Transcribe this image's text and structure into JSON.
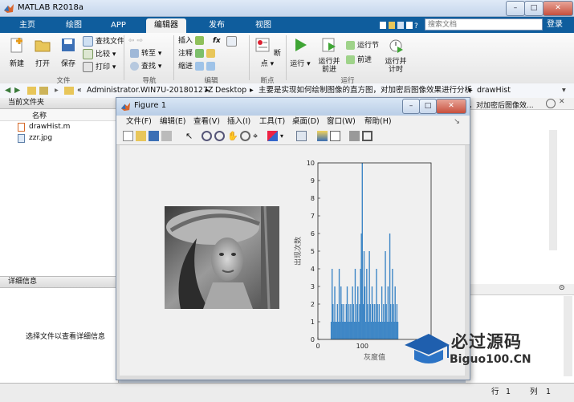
{
  "window": {
    "title": "MATLAB R2018a"
  },
  "window_controls": {
    "minimize": "–",
    "maximize": "□",
    "close": "✕"
  },
  "tabs": [
    "主页",
    "绘图",
    "APP",
    "编辑器",
    "发布",
    "视图"
  ],
  "search": {
    "placeholder": "搜索文档"
  },
  "login": "登录",
  "ribbon": {
    "file": {
      "new": "新建",
      "open": "打开",
      "save": "保存",
      "find_files": "查找文件",
      "compare": "比较",
      "print": "打印",
      "group": "文件"
    },
    "nav": {
      "goto": "转至",
      "find": "查找",
      "group": "导航"
    },
    "edit": {
      "insert": "插入",
      "fx": "fx",
      "comment": "注释",
      "indent": "缩进",
      "group": "编辑"
    },
    "breakpoints": {
      "label": "断点",
      "group": "断点"
    },
    "run": {
      "run": "运行",
      "run_advance": "运行并前进",
      "run_section": "运行节",
      "advance": "前进",
      "run_time": "运行并计时",
      "group": "运行"
    }
  },
  "path": {
    "prefix": "«",
    "segments": [
      "Administrator.WIN7U-20180127Z",
      "Desktop",
      "主要是实现如何绘制图像的直方图，对加密后图像效果进行分析",
      "drawHist"
    ]
  },
  "current_folder": {
    "header": "当前文件夹",
    "column": "名称",
    "files": [
      {
        "name": "drawHist.m",
        "icon": "m-file-icon"
      },
      {
        "name": "zzr.jpg",
        "icon": "image-file-icon"
      }
    ]
  },
  "details": {
    "header": "详细信息",
    "empty_text": "选择文件以查看详细信息"
  },
  "right_panel": {
    "header_text": "，对加密后图像效..."
  },
  "figure": {
    "title": "Figure 1",
    "menu": [
      "文件(F)",
      "编辑(E)",
      "查看(V)",
      "插入(I)",
      "工具(T)",
      "桌面(D)",
      "窗口(W)",
      "帮助(H)"
    ]
  },
  "status": {
    "row_label": "行",
    "row": "1",
    "col_label": "列",
    "col": "1"
  },
  "watermark": {
    "text": "必过源码",
    "url": "Biguo100.CN"
  },
  "colors": {
    "accent": "#0f5d9d",
    "bar": "#3f87c6"
  },
  "chart_data": {
    "type": "bar",
    "xlabel": "灰度值",
    "ylabel": "出现次数",
    "xlim": [
      0,
      255
    ],
    "ylim": [
      0,
      10
    ],
    "yticks": [
      0,
      1,
      2,
      3,
      4,
      5,
      6,
      7,
      8,
      9,
      10
    ],
    "xticks": [
      0,
      100
    ],
    "series": [
      {
        "x": [
          30,
          32,
          34,
          36,
          38,
          40,
          42,
          44,
          46,
          48,
          50,
          52,
          54,
          56,
          58,
          60,
          62,
          64,
          66,
          68,
          70,
          72,
          74,
          76,
          78,
          80,
          82,
          84,
          86,
          88,
          90,
          92,
          94,
          96,
          98,
          100,
          102,
          104,
          106,
          108,
          110,
          112,
          114,
          116,
          118,
          120,
          122,
          124,
          126,
          128,
          130,
          132,
          134,
          136,
          138,
          140,
          142,
          144,
          146,
          148,
          150,
          152,
          154,
          156,
          158,
          160,
          162,
          164,
          166,
          168,
          170,
          172,
          174,
          176,
          178,
          180
        ],
        "y": [
          1,
          4,
          2,
          1,
          3,
          1,
          1,
          2,
          1,
          4,
          1,
          3,
          2,
          1,
          2,
          1,
          1,
          2,
          3,
          1,
          2,
          1,
          2,
          1,
          3,
          2,
          1,
          4,
          1,
          2,
          3,
          1,
          2,
          4,
          6,
          10,
          2,
          5,
          3,
          1,
          4,
          2,
          1,
          5,
          2,
          1,
          3,
          2,
          1,
          2,
          1,
          4,
          2,
          1,
          2,
          1,
          1,
          3,
          1,
          2,
          1,
          5,
          2,
          1,
          3,
          1,
          6,
          2,
          1,
          4,
          2,
          1,
          3,
          1,
          2,
          1
        ]
      }
    ]
  }
}
